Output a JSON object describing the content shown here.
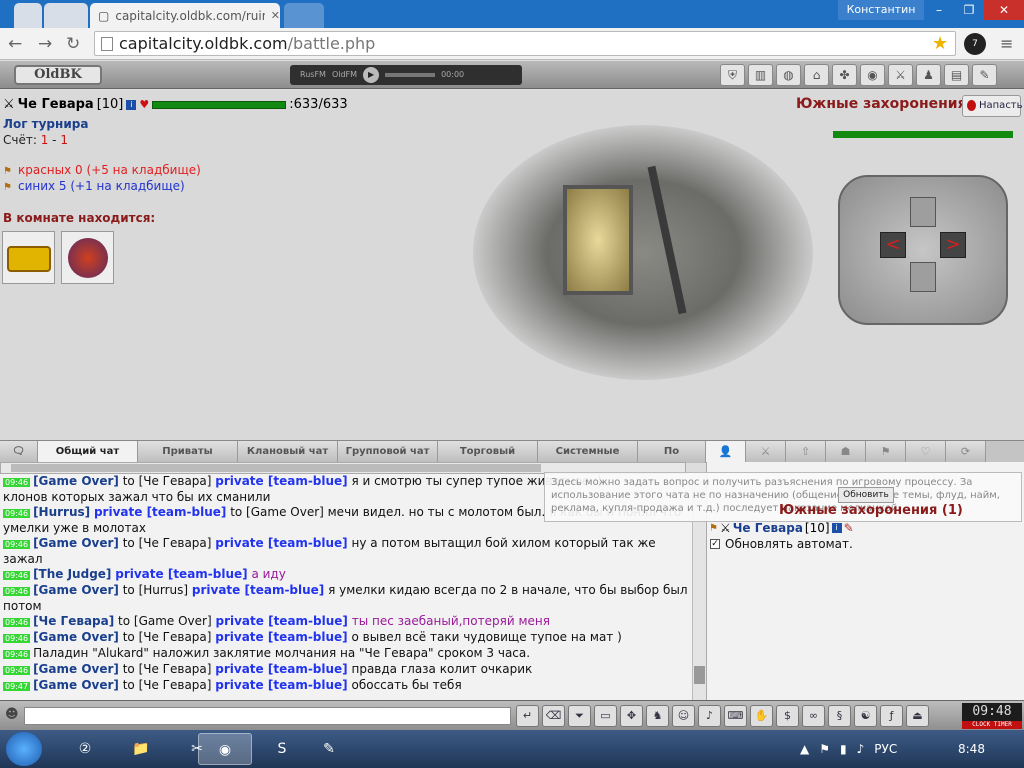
{
  "browser": {
    "user": "Константин",
    "tab_title": "capitalcity.oldbk.com/ruin",
    "url_host": "capitalcity.oldbk.com",
    "url_path": "/battle.php",
    "ext_badge": "7"
  },
  "game": {
    "logo": "OldBK",
    "radio": {
      "station1": "RusFM",
      "station2": "OldFM",
      "time": "00:00"
    }
  },
  "player": {
    "name": "Че Гевара",
    "level": "[10]",
    "hp": ":633/633",
    "hp_fraction": 1.0
  },
  "tournament": {
    "log_label": "Лог турнира",
    "score_label": "Счёт:",
    "score_red": "1",
    "score_sep": " - ",
    "score_blue": "1",
    "red": "красных 0 (+5 на кладбище)",
    "blue": "синих 5 (+1 на кладбище)",
    "room_header": "В комнате находится:"
  },
  "location": {
    "name": "Южные захоронения",
    "attack": "Напасть",
    "hp_fraction": 1.0
  },
  "chat_tabs": [
    "Общий чат",
    "Приваты",
    "Клановый чат",
    "Групповой чат",
    "Торговый",
    "Системные",
    "По"
  ],
  "chat": [
    {
      "time": "09:46",
      "who": "[Game Over]",
      "to": " to [Че Гевара] ",
      "priv": "private [team-blue]",
      "text": " я и смотрю ты супер тупое животное :)",
      "cls": "sys"
    },
    {
      "time": "",
      "who": "",
      "to": "",
      "priv": "",
      "text": "клонов которых зажал что бы их сманили",
      "cls": "sys"
    },
    {
      "time": "09:46",
      "who": "[Hurrus]",
      "to": " ",
      "priv": "private [team-blue]",
      "text": " to [Game Over] мечи видел. но ты с молотом был. я как бы и понял что",
      "cls": "sys"
    },
    {
      "time": "",
      "who": "",
      "to": "",
      "priv": "",
      "text": "умелки уже в молотах",
      "cls": "sys"
    },
    {
      "time": "09:46",
      "who": "[Game Over]",
      "to": " to [Че Гевара] ",
      "priv": "private [team-blue]",
      "text": " ну а потом вытащил бой хилом который так же",
      "cls": "sys"
    },
    {
      "time": "",
      "who": "",
      "to": "",
      "priv": "",
      "text": "зажал",
      "cls": "sys"
    },
    {
      "time": "09:46",
      "who": "[The Judge]",
      "to": " ",
      "priv": "private [team-blue]",
      "text": " а иду",
      "cls": "purple"
    },
    {
      "time": "09:46",
      "who": "[Game Over]",
      "to": " to [Hurrus] ",
      "priv": "private [team-blue]",
      "text": " я умелки кидаю всегда по 2 в начале, что бы выбор был",
      "cls": "sys"
    },
    {
      "time": "",
      "who": "",
      "to": "",
      "priv": "",
      "text": "потом",
      "cls": "sys"
    },
    {
      "time": "09:46",
      "who": "[Че Гевара]",
      "to": " to [Game Over] ",
      "priv": "private [team-blue]",
      "text": " ты пес заебаный,потеряй меня",
      "cls": "purple"
    },
    {
      "time": "09:46",
      "who": "[Game Over]",
      "to": " to [Че Гевара] ",
      "priv": "private [team-blue]",
      "text": " о вывел всё таки чудовище тупое на мат )",
      "cls": "sys"
    },
    {
      "time": "09:46",
      "who": "",
      "to": "",
      "priv": "",
      "text": "Паладин \"Alukard\" наложил заклятие молчания на \"Че Гевара\" сроком 3 часа.",
      "cls": "sys"
    },
    {
      "time": "09:46",
      "who": "[Game Over]",
      "to": " to [Че Гевара] ",
      "priv": "private [team-blue]",
      "text": " правда глаза колит очкарик",
      "cls": "sys"
    },
    {
      "time": "09:47",
      "who": "[Game Over]",
      "to": " to [Че Гевара] ",
      "priv": "private [team-blue]",
      "text": " обоссать бы тебя",
      "cls": "sys"
    }
  ],
  "right_panel": {
    "tooltip": "Здесь можно задать вопрос и получить разъяснения по игровому процессу. За использование этого чата не по назначению (общение на другие темы, флуд, найм, реклама, купля-продажа и т.д.) последует наказание молчанкой.",
    "refresh": "Обновить",
    "location": "Южные захоронения (1)",
    "user": "Че Гевара",
    "user_level": "[10]",
    "auto": "Обновлять автомат."
  },
  "clock": {
    "time": "09:48",
    "sub": "CLOCK  TIMER"
  },
  "taskbar": {
    "lang": "РУС",
    "time": "8:48"
  }
}
